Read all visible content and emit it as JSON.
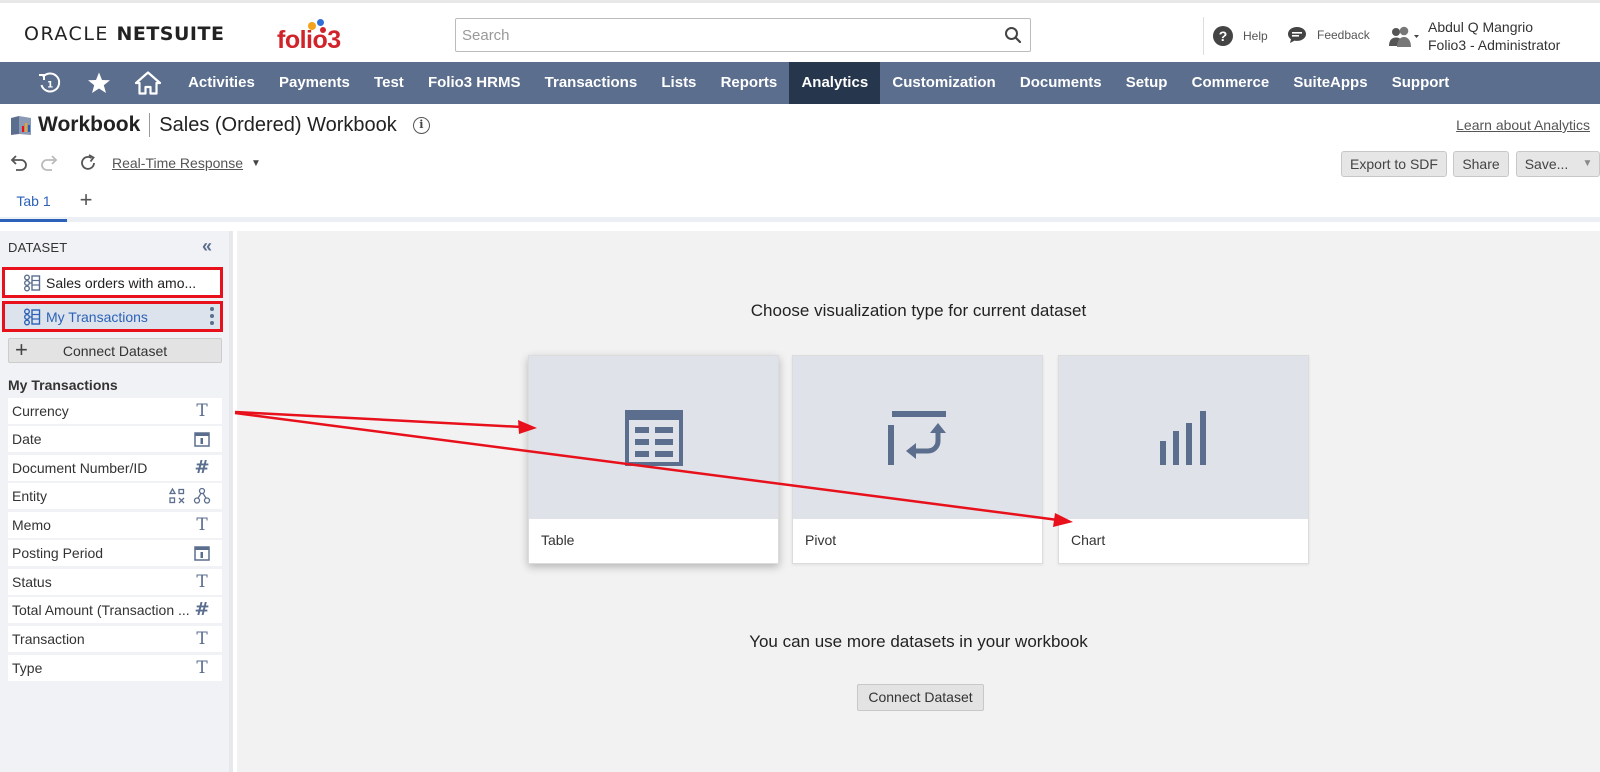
{
  "header": {
    "logo_oracle_a": "ORACLE",
    "logo_oracle_b": "NETSUITE",
    "logo_folio": "folio3",
    "search_placeholder": "Search",
    "help_label": "Help",
    "feedback_label": "Feedback",
    "user_name": "Abdul Q Mangrio",
    "user_role": "Folio3 - Administrator"
  },
  "nav": {
    "items": [
      "Activities",
      "Payments",
      "Test",
      "Folio3 HRMS",
      "Transactions",
      "Lists",
      "Reports",
      "Analytics",
      "Customization",
      "Documents",
      "Setup",
      "Commerce",
      "SuiteApps",
      "Support"
    ],
    "active": "Analytics"
  },
  "page": {
    "workbook_label": "Workbook",
    "workbook_name": "Sales (Ordered) Workbook",
    "learn_link": "Learn about Analytics",
    "realtime_label": "Real-Time Response",
    "export_btn": "Export to SDF",
    "share_btn": "Share",
    "save_btn": "Save..."
  },
  "tabs": {
    "items": [
      "Tab 1"
    ]
  },
  "sidebar": {
    "header": "DATASET",
    "datasets": [
      "Sales orders with amo...",
      "My Transactions"
    ],
    "connect_label": "Connect Dataset",
    "fields_title": "My Transactions",
    "fields": [
      {
        "label": "Currency",
        "type": "text"
      },
      {
        "label": "Date",
        "type": "date"
      },
      {
        "label": "Document Number/ID",
        "type": "number"
      },
      {
        "label": "Entity",
        "type": "entity"
      },
      {
        "label": "Memo",
        "type": "text"
      },
      {
        "label": "Posting Period",
        "type": "date"
      },
      {
        "label": "Status",
        "type": "text"
      },
      {
        "label": "Total Amount (Transaction ...",
        "type": "number"
      },
      {
        "label": "Transaction",
        "type": "text"
      },
      {
        "label": "Type",
        "type": "text"
      }
    ]
  },
  "main": {
    "choose_title": "Choose visualization type for current dataset",
    "cards": [
      "Table",
      "Pivot",
      "Chart"
    ],
    "more_title": "You can use more datasets in your workbook",
    "connect_label": "Connect Dataset"
  },
  "colors": {
    "nav_bg": "#5b6e8e",
    "nav_active": "#26364d",
    "accent_blue": "#2b62b8",
    "highlight_red": "#e8101b",
    "icon_slate": "#5b6e8e"
  }
}
